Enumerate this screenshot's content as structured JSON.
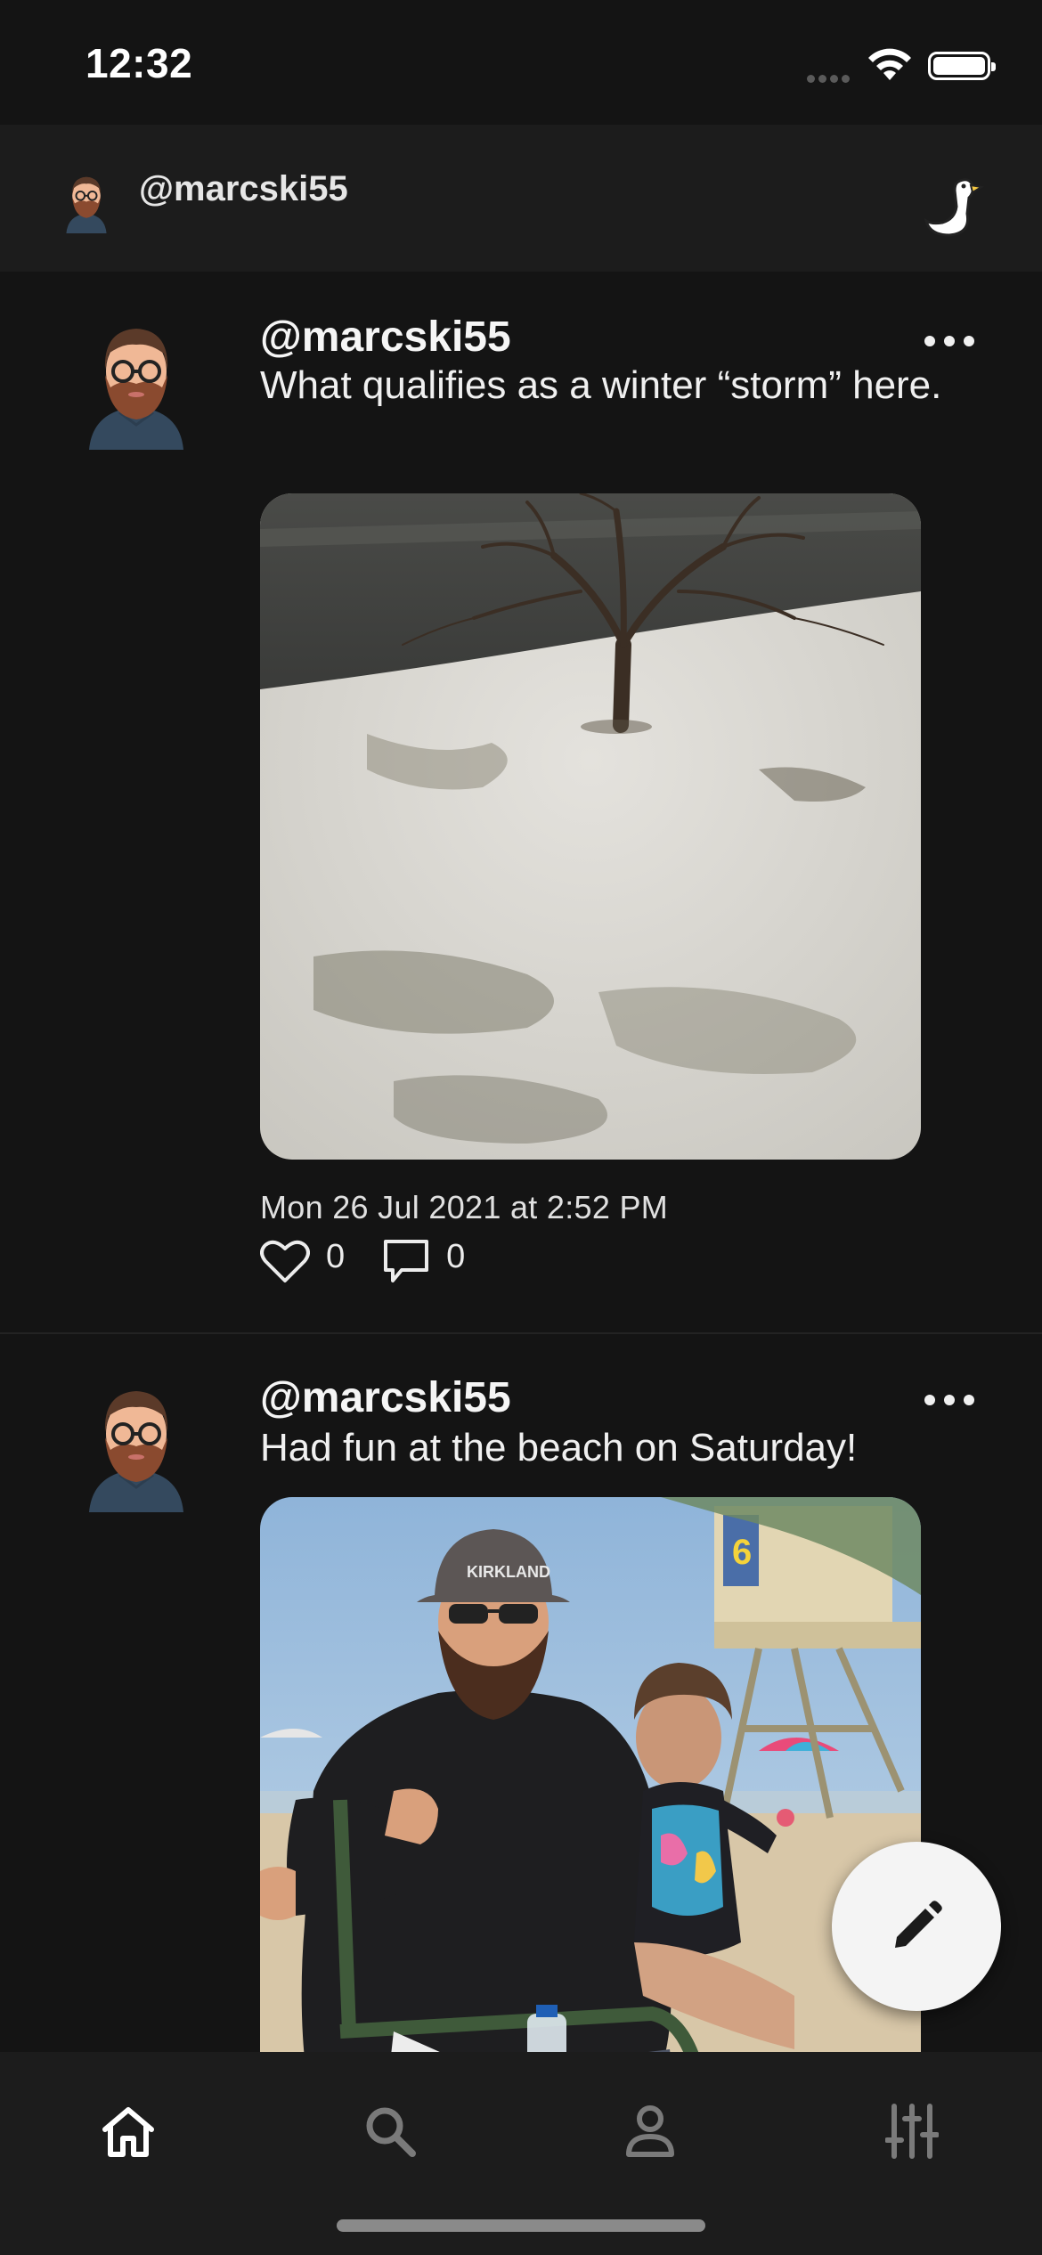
{
  "status_bar": {
    "time": "12:32",
    "icons": [
      "signal-icon",
      "wifi-icon",
      "battery-icon"
    ]
  },
  "header": {
    "handle": "@marcski55",
    "logo_icon": "goose-logo-icon"
  },
  "posts": [
    {
      "handle": "@marcski55",
      "text": "What qualifies as a winter “storm” here.",
      "image": "snowy lawn with bare tree",
      "date": "Mon 26 Jul 2021 at 2:52 PM",
      "likes": "0",
      "comments": "0"
    },
    {
      "handle": "@marcski55",
      "text": "Had fun at the beach on Saturday!",
      "image": "man and child at beach by lifeguard tower"
    }
  ],
  "fab": {
    "icon": "pencil-icon"
  },
  "tabs": [
    {
      "name": "home",
      "icon": "home-icon",
      "active": true
    },
    {
      "name": "search",
      "icon": "search-icon",
      "active": false
    },
    {
      "name": "profile",
      "icon": "person-icon",
      "active": false
    },
    {
      "name": "settings",
      "icon": "sliders-icon",
      "active": false
    }
  ],
  "colors": {
    "background": "#141414",
    "header": "#1c1c1c",
    "text": "#f2f2f2",
    "inactive_tab": "#7a7a7a"
  }
}
